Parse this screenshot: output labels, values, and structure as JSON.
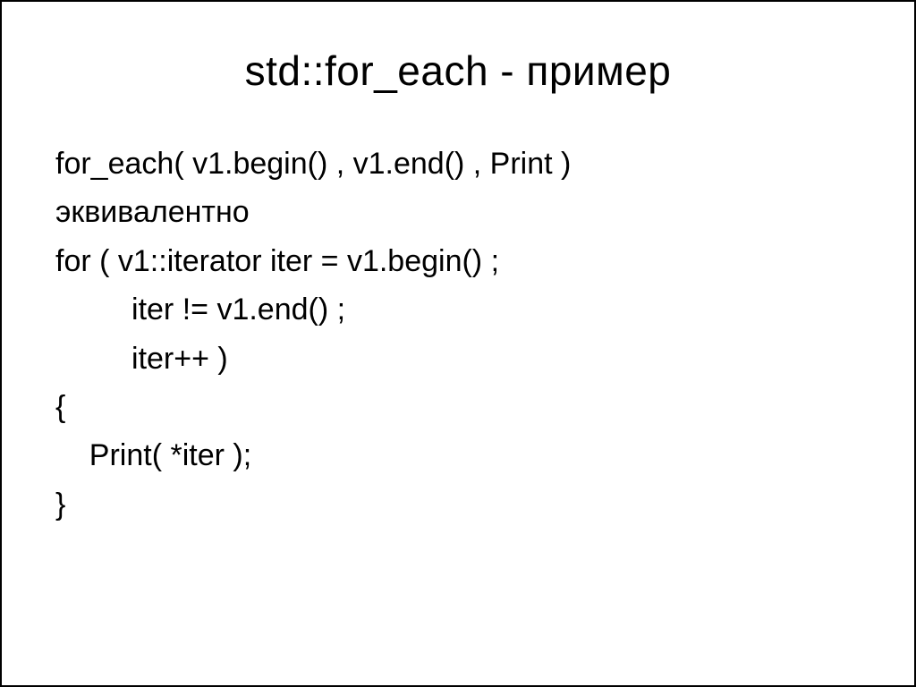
{
  "slide": {
    "title": "std::for_each - пример",
    "lines": [
      "for_each( v1.begin() , v1.end() , Print )",
      "эквивалентно",
      "for ( v1::iterator iter = v1.begin() ;",
      "         iter != v1.end() ;",
      "         iter++ )",
      "{",
      "    Print( *iter );",
      "}"
    ]
  }
}
